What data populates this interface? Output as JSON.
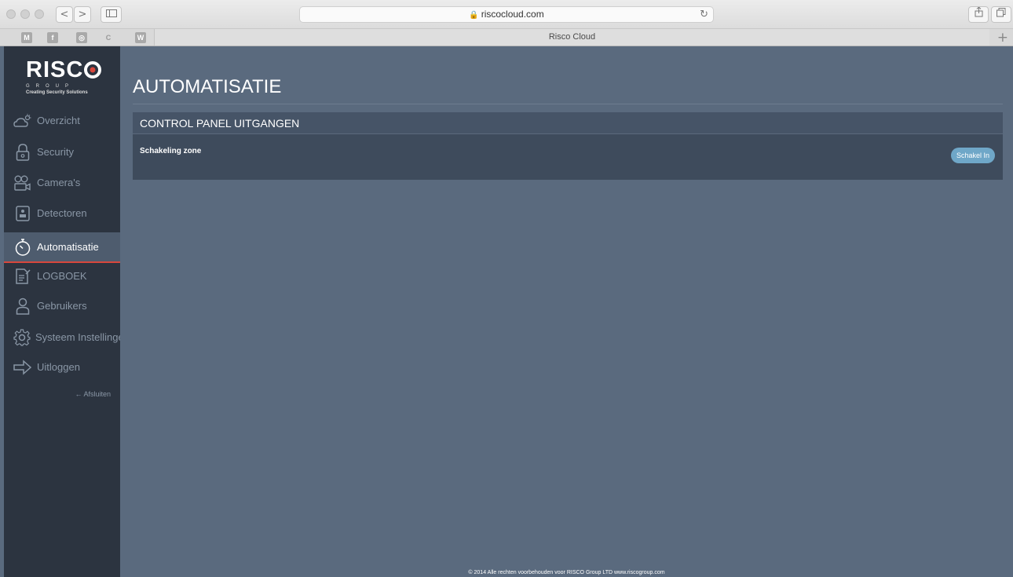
{
  "browser": {
    "url": "riscocloud.com",
    "tab_title": "Risco Cloud",
    "nav_back": "<",
    "nav_forward": ">",
    "favorites": [
      "M",
      "f",
      "◎",
      "C",
      "W"
    ]
  },
  "sidebar": {
    "logo": {
      "brand": "RISC",
      "group": "GROUP",
      "slogan": "Creating Security Solutions"
    },
    "items": [
      {
        "label": "Overzicht",
        "icon": "cloud-sun-icon"
      },
      {
        "label": "Security",
        "icon": "lock-icon"
      },
      {
        "label": "Camera's",
        "icon": "camera-icon"
      },
      {
        "label": "Detectoren",
        "icon": "detector-icon"
      },
      {
        "label": "Automatisatie",
        "icon": "stopwatch-icon",
        "active": true
      },
      {
        "label": "LOGBOEK",
        "icon": "logbook-icon"
      },
      {
        "label": "Gebruikers",
        "icon": "user-icon"
      },
      {
        "label": "Systeem Instellingen",
        "icon": "gear-icon"
      },
      {
        "label": "Uitloggen",
        "icon": "logout-arrow-icon"
      }
    ],
    "close_label": "← Afsluiten"
  },
  "main": {
    "title": "AUTOMATISATIE",
    "panel": {
      "heading": "CONTROL PANEL UITGANGEN",
      "rows": [
        {
          "label": "Schakeling zone",
          "button": "Schakel In"
        }
      ]
    },
    "footer": "© 2014 Alle rechten voorbehouden voor RISCO Group LTD www.riscogroup.com"
  },
  "colors": {
    "sidebar_bg": "#2c3440",
    "main_bg": "#5a6a7e",
    "panel_bg": "#3e4b5c",
    "active_accent": "#d8473c",
    "button_bg": "#6fa7c8"
  }
}
